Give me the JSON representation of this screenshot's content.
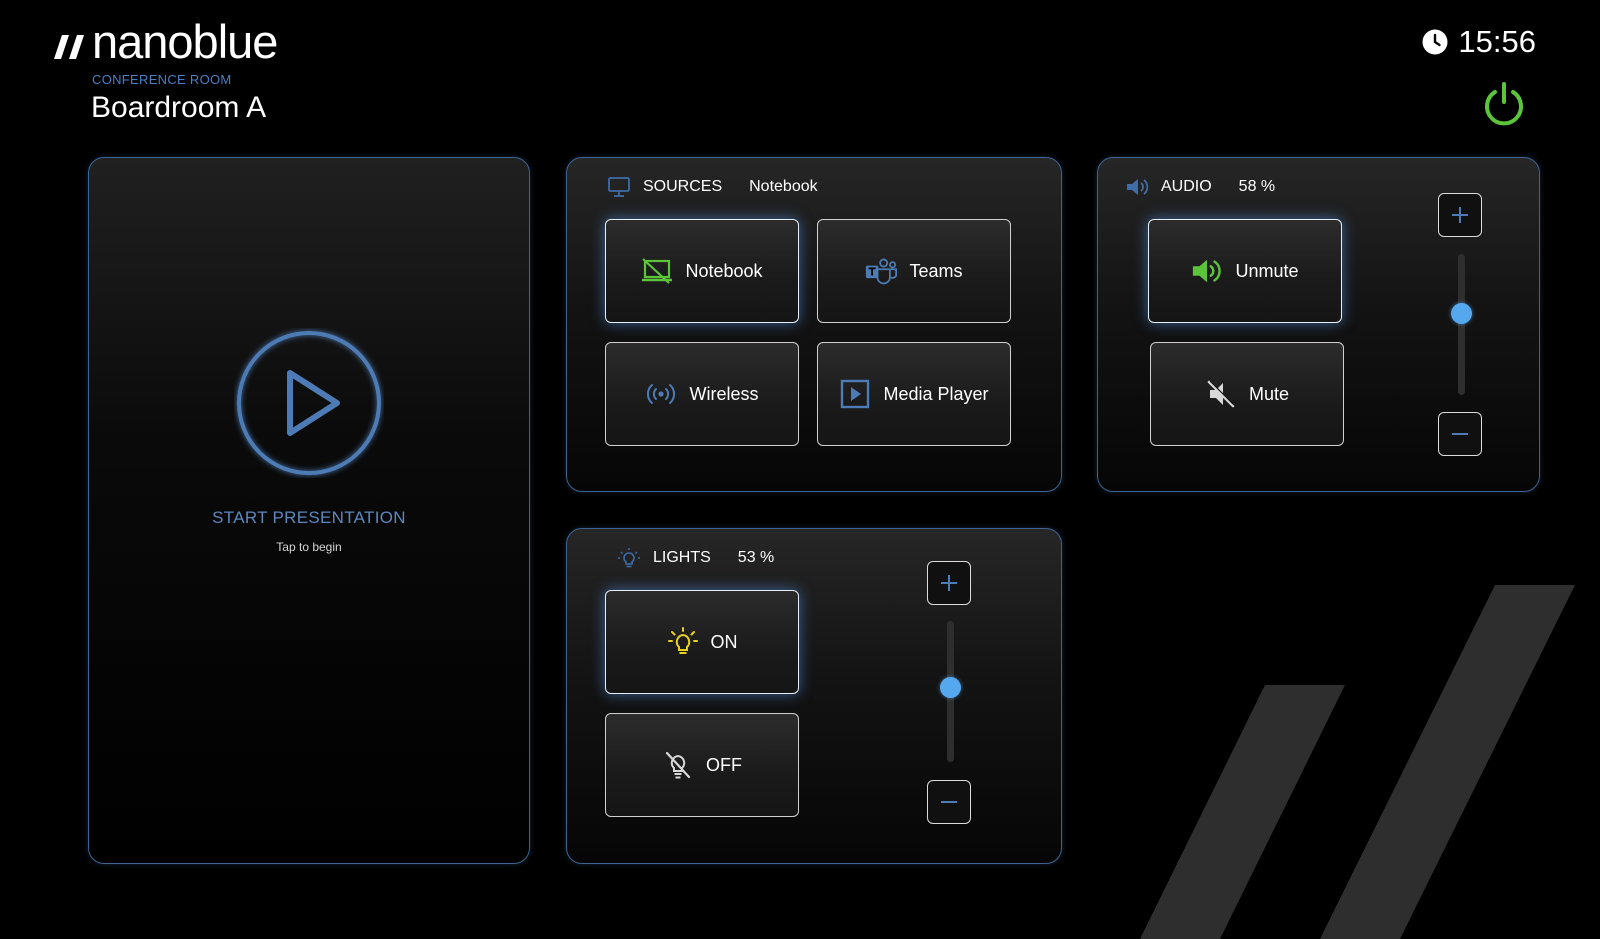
{
  "brand": {
    "name": "nanoblue"
  },
  "room": {
    "subtitle": "CONFERENCE ROOM",
    "name": "Boardroom A"
  },
  "clock": {
    "time": "15:56"
  },
  "presentation": {
    "title": "START PRESENTATION",
    "hint": "Tap to begin"
  },
  "sources": {
    "title": "SOURCES",
    "current": "Notebook",
    "buttons": [
      {
        "label": "Notebook",
        "icon": "notebook-icon",
        "active": true
      },
      {
        "label": "Teams",
        "icon": "teams-icon",
        "active": false
      },
      {
        "label": "Wireless",
        "icon": "wireless-icon",
        "active": false
      },
      {
        "label": "Media Player",
        "icon": "media-player-icon",
        "active": false
      }
    ]
  },
  "audio": {
    "title": "AUDIO",
    "level_text": "58 %",
    "level": 58,
    "buttons": [
      {
        "label": "Unmute",
        "icon": "speaker-icon",
        "active": true
      },
      {
        "label": "Mute",
        "icon": "speaker-muted-icon",
        "active": false
      }
    ]
  },
  "lights": {
    "title": "LIGHTS",
    "level_text": "53 %",
    "level": 53,
    "buttons": [
      {
        "label": "ON",
        "icon": "bulb-on-icon",
        "active": true
      },
      {
        "label": "OFF",
        "icon": "bulb-off-icon",
        "active": false
      }
    ]
  },
  "colors": {
    "accent": "#56a8ee",
    "panel_border": "#3d6594",
    "subtitle": "#4a7fc4",
    "power": "#5cc43a",
    "green_icon": "#5cc43a",
    "bulb": "#e8d21d"
  }
}
